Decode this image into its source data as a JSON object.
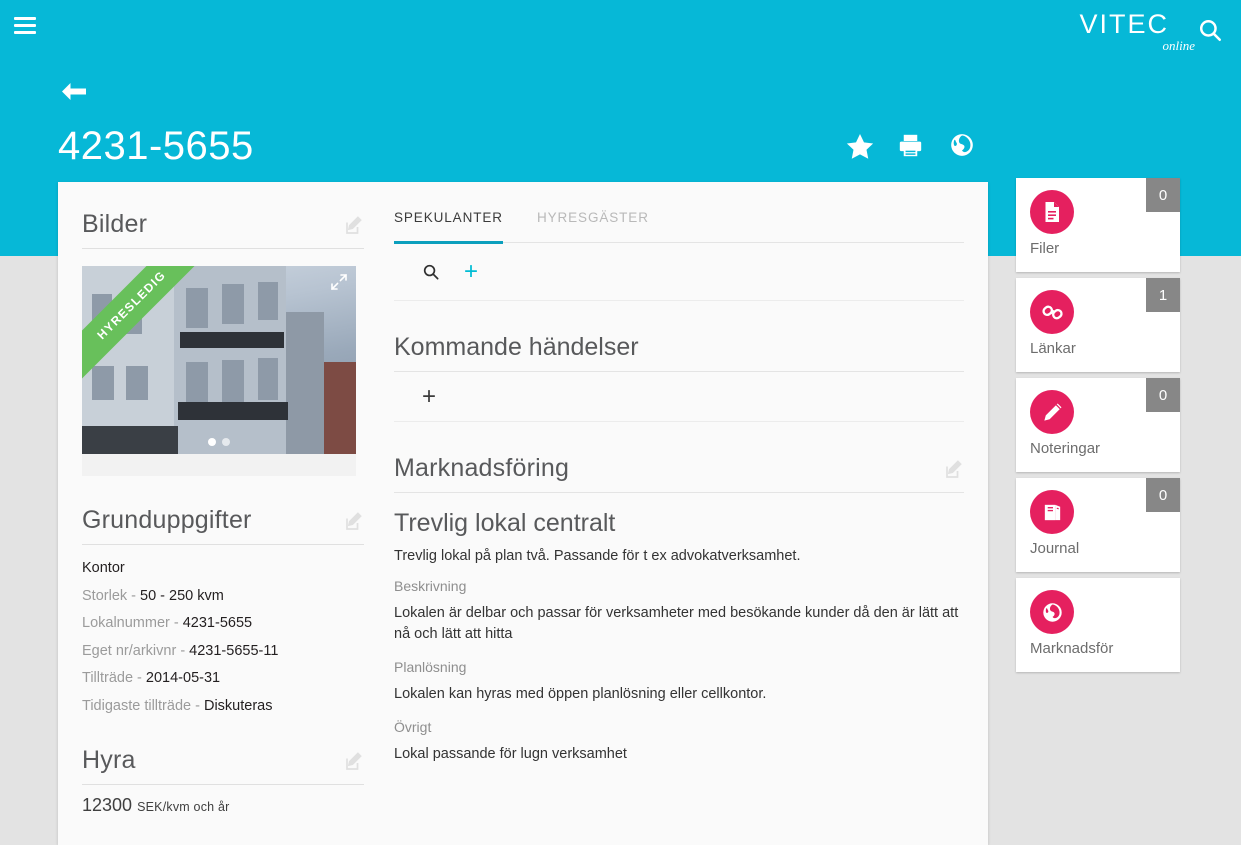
{
  "header": {
    "menu_icon": "hamburger-icon",
    "brand_main": "VITEC",
    "brand_sub": "online",
    "search_icon": "search-icon",
    "back_icon": "back-arrow-icon",
    "record_title": "4231-5655",
    "actions": [
      {
        "name": "favorite-star-icon",
        "label": "Favorit"
      },
      {
        "name": "print-icon",
        "label": "Skriv ut"
      },
      {
        "name": "globe-icon",
        "label": "Publicera"
      }
    ],
    "accent_color": "#06b8d7"
  },
  "left": {
    "bilder": {
      "title": "Bilder",
      "edit_icon": "edit-icon",
      "ribbon": "HYRESLEDIG",
      "expand_icon": "expand-icon",
      "dots": 2,
      "active_dot": 1
    },
    "grunduppgifter": {
      "title": "Grunduppgifter",
      "edit_icon": "edit-icon",
      "facts": [
        {
          "label": "",
          "value": "Kontor"
        },
        {
          "label": "Storlek - ",
          "value": "50 - 250 kvm"
        },
        {
          "label": "Lokalnummer - ",
          "value": "4231-5655"
        },
        {
          "label": "Eget nr/arkivnr - ",
          "value": "4231-5655-11"
        },
        {
          "label": "Tillträde - ",
          "value": "2014-05-31"
        },
        {
          "label": "Tidigaste tillträde - ",
          "value": "Diskuteras"
        }
      ]
    },
    "hyra": {
      "title": "Hyra",
      "edit_icon": "edit-icon",
      "amount": "12300",
      "unit": "SEK/kvm och år"
    }
  },
  "main": {
    "tabs": [
      {
        "label": "SPEKULANTER",
        "active": true
      },
      {
        "label": "HYRESGÄSTER",
        "active": false
      }
    ],
    "toolbar": {
      "search_icon": "search-icon",
      "add_label": "+"
    },
    "kommande": {
      "title": "Kommande händelser",
      "add_label": "+"
    },
    "marknadsforing": {
      "title": "Marknadsföring",
      "edit_icon": "edit-icon",
      "headline": "Trevlig lokal centralt",
      "intro": "Trevlig lokal på plan två. Passande för t ex advokatverksamhet.",
      "fields": [
        {
          "label": "Beskrivning",
          "text": "Lokalen är delbar och passar för verksamheter med besökande kunder då den är lätt att nå och lätt att hitta"
        },
        {
          "label": "Planlösning",
          "text": "Lokalen kan hyras med öppen planlösning eller cellkontor."
        },
        {
          "label": "Övrigt",
          "text": "Lokal passande för lugn verksamhet"
        }
      ]
    }
  },
  "rail": {
    "accent_color": "#e5205f",
    "badge_color": "#878787",
    "cards": [
      {
        "label": "Filer",
        "badge": "0",
        "icon": "file-document-icon"
      },
      {
        "label": "Länkar",
        "badge": "1",
        "icon": "link-chain-icon"
      },
      {
        "label": "Noteringar",
        "badge": "0",
        "icon": "pencil-icon"
      },
      {
        "label": "Journal",
        "badge": "0",
        "icon": "book-icon"
      },
      {
        "label": "Marknadsför",
        "badge": "",
        "icon": "globe-icon"
      }
    ]
  }
}
